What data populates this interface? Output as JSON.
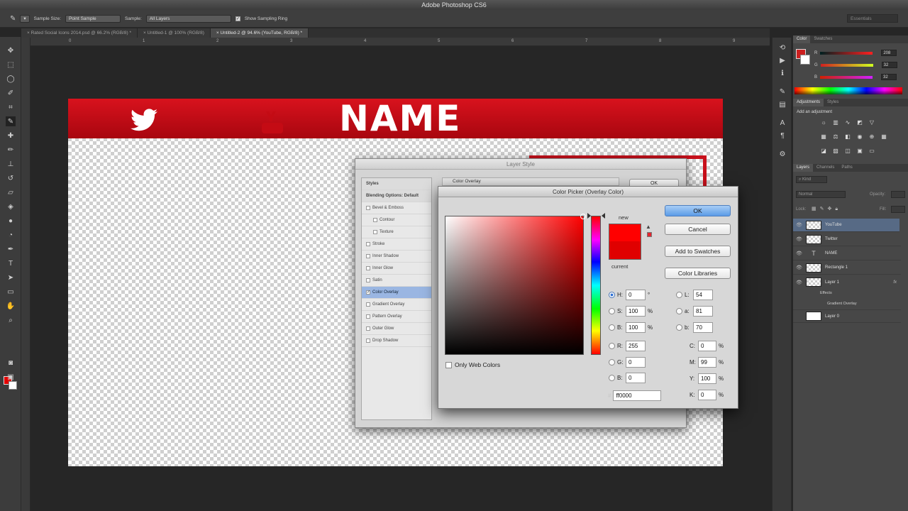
{
  "app": {
    "title": "Adobe Photoshop CS6"
  },
  "options": {
    "sample_size_label": "Sample Size:",
    "sample_size_value": "Point Sample",
    "sample_label": "Sample:",
    "sample_value": "All Layers",
    "show_ring_label": "Show Sampling Ring",
    "workspace": "Essentials"
  },
  "tabs": [
    {
      "label": "Rated Social Icons 2014.psd @ 66.2% (RGB/8) *"
    },
    {
      "label": "Untitled-1 @ 100% (RGB/8)"
    },
    {
      "label": "Untitled-2 @ 94.6% (YouTube, RGB/8) *"
    }
  ],
  "ruler": {
    "numbers": [
      "0",
      "1",
      "2",
      "3",
      "4",
      "5",
      "6",
      "7",
      "8",
      "9"
    ]
  },
  "canvas": {
    "banner_title": "NAME"
  },
  "layer_style": {
    "title": "Layer Style",
    "panel_title": "Color Overlay",
    "ok": "OK",
    "items": [
      {
        "label": "Styles",
        "kind": "head"
      },
      {
        "label": "Blending Options: Default",
        "kind": "head"
      },
      {
        "label": "Bevel & Emboss",
        "kind": "check"
      },
      {
        "label": "Contour",
        "kind": "sub"
      },
      {
        "label": "Texture",
        "kind": "sub"
      },
      {
        "label": "Stroke",
        "kind": "check"
      },
      {
        "label": "Inner Shadow",
        "kind": "check"
      },
      {
        "label": "Inner Glow",
        "kind": "check"
      },
      {
        "label": "Satin",
        "kind": "check"
      },
      {
        "label": "Color Overlay",
        "kind": "checked"
      },
      {
        "label": "Gradient Overlay",
        "kind": "check"
      },
      {
        "label": "Pattern Overlay",
        "kind": "check"
      },
      {
        "label": "Outer Glow",
        "kind": "check"
      },
      {
        "label": "Drop Shadow",
        "kind": "check"
      }
    ]
  },
  "color_picker": {
    "title": "Color Picker (Overlay Color)",
    "new_label": "new",
    "current_label": "current",
    "new_color": "#ff0000",
    "current_color": "#e00000",
    "buttons": {
      "ok": "OK",
      "cancel": "Cancel",
      "add_swatches": "Add to Swatches",
      "color_libraries": "Color Libraries"
    },
    "only_web_colors": "Only Web Colors",
    "hsb": [
      {
        "label": "H:",
        "value": "0",
        "unit": "°",
        "checked": true
      },
      {
        "label": "S:",
        "value": "100",
        "unit": "%"
      },
      {
        "label": "B:",
        "value": "100",
        "unit": "%"
      }
    ],
    "rgb": [
      {
        "label": "R:",
        "value": "255"
      },
      {
        "label": "G:",
        "value": "0"
      },
      {
        "label": "B:",
        "value": "0"
      }
    ],
    "lab": [
      {
        "label": "L:",
        "value": "54"
      },
      {
        "label": "a:",
        "value": "81"
      },
      {
        "label": "b:",
        "value": "70"
      }
    ],
    "cmyk": [
      {
        "label": "C:",
        "value": "0",
        "unit": "%"
      },
      {
        "label": "M:",
        "value": "99",
        "unit": "%"
      },
      {
        "label": "Y:",
        "value": "100",
        "unit": "%"
      },
      {
        "label": "K:",
        "value": "0",
        "unit": "%"
      }
    ],
    "hex_label": "#",
    "hex": "ff0000"
  },
  "color_panel": {
    "tabs": [
      "Color",
      "Swatches"
    ],
    "sliders": [
      {
        "label": "R",
        "value": "208"
      },
      {
        "label": "G",
        "value": "32"
      },
      {
        "label": "B",
        "value": "32"
      }
    ]
  },
  "adjustments": {
    "tabs": [
      "Adjustments",
      "Styles"
    ],
    "add_label": "Add an adjustment"
  },
  "layers": {
    "tabs": [
      "Layers",
      "Channels",
      "Paths"
    ],
    "kind_label": "Kind",
    "blend_mode": "Normal",
    "opacity_label": "Opacity:",
    "lock_label": "Lock:",
    "fill_label": "Fill:",
    "items": [
      {
        "name": "YouTube",
        "thumb": "checker",
        "selected": true
      },
      {
        "name": "Twitter",
        "thumb": "checker"
      },
      {
        "name": "NAME",
        "thumb": "text"
      },
      {
        "name": "Rectangle 1",
        "thumb": "checker"
      },
      {
        "name": "Layer 1",
        "thumb": "checker",
        "fx": true
      }
    ],
    "effects_label": "Effects",
    "gradient_overlay_label": "Gradient Overlay",
    "background_layer": "Layer 0"
  }
}
